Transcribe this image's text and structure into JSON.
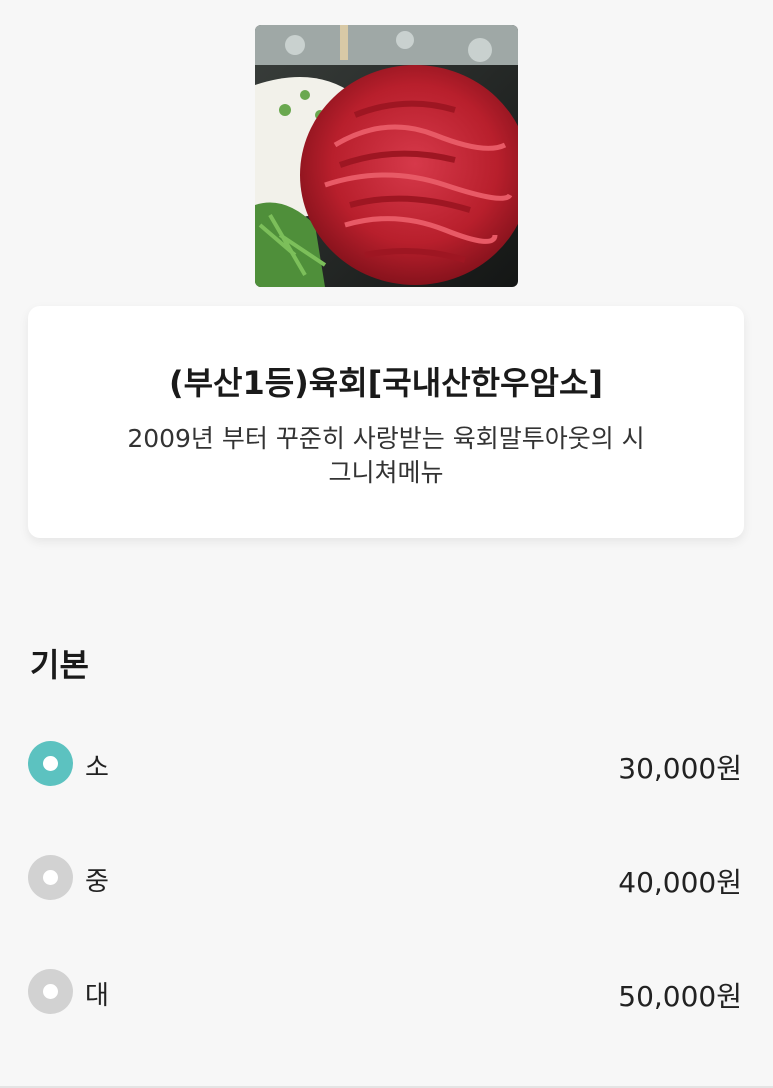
{
  "menu": {
    "title": "(부산1등)육회[국내산한우암소]",
    "description": "2009년 부터 꾸준히 사랑받는 육회말투아웃의 시그니쳐메뉴"
  },
  "section": {
    "title": "기본"
  },
  "options": [
    {
      "label": "소",
      "price": "30,000원",
      "selected": true
    },
    {
      "label": "중",
      "price": "40,000원",
      "selected": false
    },
    {
      "label": "대",
      "price": "50,000원",
      "selected": false
    }
  ],
  "colors": {
    "accent": "#5cc2c0",
    "radio_unselected": "#d2d2d2",
    "background": "#f7f7f7"
  }
}
